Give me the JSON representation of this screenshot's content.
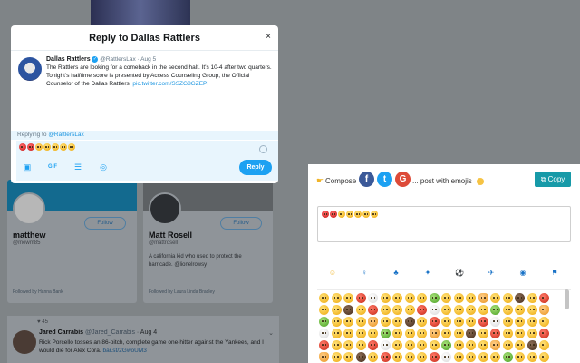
{
  "modal": {
    "title": "Reply to Dallas Rattlers",
    "close": "×"
  },
  "original_tweet": {
    "name": "Dallas Rattlers",
    "handle": "@RattlersLax",
    "date": "· Aug 5",
    "text": "The Rattlers are looking for a comeback in the second half. It's 10-4 after two quarters. Tonight's halftime score is presented by Access Counseling Group, the Official Counselor of the Dallas Rattlers. ",
    "link": "pic.twitter.com/SSZG8GZEPI"
  },
  "replying": {
    "label": "Replying to ",
    "handle": "@RattlersLax"
  },
  "compose": {
    "emojis": [
      "red",
      "red",
      "pink",
      "yellow",
      "yellow",
      "yellow",
      "yellow"
    ]
  },
  "toolbar": {
    "reply_label": "Reply",
    "icons": [
      "image-icon",
      "gif-icon",
      "poll-icon",
      "location-icon"
    ]
  },
  "background": {
    "card1": {
      "name": "matthew",
      "handle": "@mewm85",
      "follow": "Follow",
      "followed_by": "Followed by Hanna Bank"
    },
    "card2": {
      "name": "Matt Rosell",
      "handle": "@mattrosell",
      "follow": "Follow",
      "bio": "A california kid who used to protect the barricade. @lionelrowsy",
      "followed_by": "Followed by Laura Linda Bradley"
    },
    "tweet": {
      "likes": "♥ 45",
      "name": "Jared Carrabis",
      "handle": "@Jared_Carrabis",
      "date": "· Aug 4",
      "text": "Rick Porcello tosses an 86-pitch, complete game one-hitter against the Yankees, and I would die for Alex Cora. ",
      "link": "bar.st/2GwoUM3"
    }
  },
  "extension": {
    "compose_label": "Compose",
    "post_label": "... post with emojis",
    "copy_label": "Copy",
    "text_emojis": [
      "red",
      "red",
      "yellow",
      "yellow",
      "yellow",
      "yellow",
      "yellow"
    ],
    "categories": [
      "smileys-icon",
      "people-icon",
      "nature-icon",
      "animals-icon",
      "sports-icon",
      "travel-icon",
      "objects-icon",
      "flags-icon"
    ]
  }
}
